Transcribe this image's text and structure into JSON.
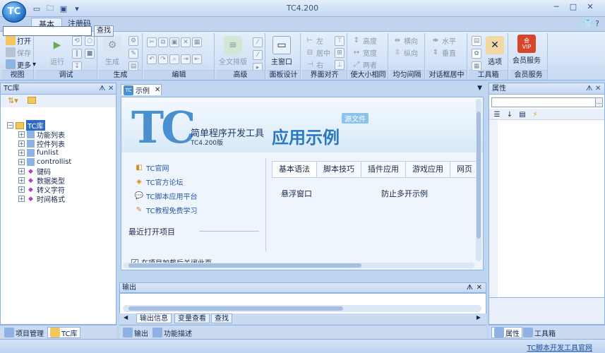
{
  "window": {
    "title": "TC4.200",
    "logo_text": "TC"
  },
  "ribbon_tabs": [
    "基本",
    "注册码"
  ],
  "ribbon": {
    "view": {
      "label": "视图",
      "open": "打开",
      "save": "保存",
      "more": "更多"
    },
    "debug": {
      "label": "调试",
      "run": "运行"
    },
    "generate": {
      "label": "生成",
      "generate": "生成"
    },
    "edit": {
      "label": "编辑"
    },
    "advanced": {
      "label": "高级",
      "full_format": "全文排版"
    },
    "panel_design": {
      "label": "面板设计",
      "main_window": "主窗口"
    },
    "align": {
      "label": "界面对齐",
      "left": "左",
      "center": "居中",
      "right": "右"
    },
    "size": {
      "label": "使大小相同",
      "height": "高度",
      "width": "宽度",
      "both": "两者"
    },
    "spacing": {
      "label": "均匀间隔",
      "horizontal": "横向",
      "vertical": "纵向"
    },
    "dialog_center": {
      "label": "对话框居中",
      "horizontal": "水平",
      "vertical": "垂直"
    },
    "toolbox": {
      "label": "工具箱",
      "options": "选项"
    },
    "member": {
      "label": "会员服务",
      "service": "会员服务",
      "vip": "VIP",
      "badge": "会"
    }
  },
  "left_panel": {
    "title": "TC库",
    "search_button": "查找",
    "tree": {
      "root": "TC库",
      "items": [
        "功能列表",
        "控件列表",
        "funlist",
        "controllist",
        "键码",
        "数据类型",
        "转义字符",
        "时间格式"
      ]
    },
    "footer_tabs": [
      "项目管理",
      "TC库"
    ]
  },
  "document": {
    "tab_label": "示例",
    "hero": {
      "logo": "TC",
      "subtitle": "简单程序开发工具",
      "version": "TC4.200版",
      "title": "应用示例",
      "badge": "源文件"
    },
    "links": [
      "TC官网",
      "TC官方论坛",
      "TC脚本应用平台",
      "TC教程免费学习"
    ],
    "recent_title": "最近打开项目",
    "categories": [
      "基本语法",
      "脚本技巧",
      "插件应用",
      "游戏应用",
      "网页"
    ],
    "samples": [
      "悬浮窗口",
      "防止多开示例"
    ],
    "close_checkbox": "在项目加载后关闭此页"
  },
  "output": {
    "title": "输出",
    "tabs": [
      "输出信息",
      "变量查看",
      "查找"
    ],
    "footer_tabs": [
      "输出",
      "功能描述"
    ]
  },
  "right_panel": {
    "title": "属性",
    "footer_tabs": [
      "属性",
      "工具箱"
    ]
  },
  "status": {
    "link": "TC脚本开发工具官网"
  },
  "colors": {
    "ribbon_bg": "#d4e3f6",
    "accent": "#2b78c2",
    "border": "#8db2e3"
  }
}
